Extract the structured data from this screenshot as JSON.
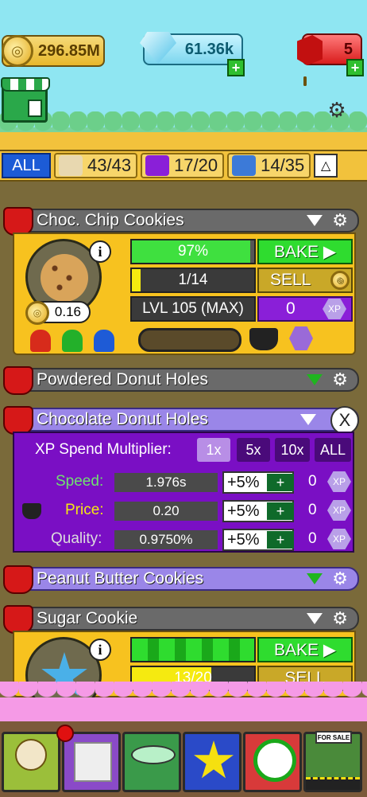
{
  "currency": {
    "coins": "296.85M",
    "gems": "61.36k",
    "tickets": "5"
  },
  "filters": {
    "all_label": "ALL",
    "cookies": "43/43",
    "boxes": "17/20",
    "gifts": "14/35"
  },
  "bakery_items": [
    {
      "name": "Choc. Chip Cookies",
      "progress_label": "97%",
      "progress_fraction": 0.97,
      "bake_label": "BAKE ▶",
      "stock_label": "1/14",
      "stock_fraction": 0.0714,
      "sell_label": "SELL",
      "level_label": "LVL 105 (MAX)",
      "xp_value": "0",
      "xp_badge": "XP",
      "price": "0.16",
      "info": "i"
    },
    {
      "name": "Powdered Donut Holes"
    },
    {
      "name": "Chocolate Donut Holes",
      "close": "X",
      "xp_spend_label": "XP Spend Multiplier:",
      "multipliers": [
        "1x",
        "5x",
        "10x",
        "ALL"
      ],
      "stats": [
        {
          "label": "Speed:",
          "value": "1.976s",
          "pct": "+5%",
          "plus": "+",
          "xp": "0",
          "xp_badge": "XP"
        },
        {
          "label": "Price:",
          "value": "0.20",
          "pct": "+5%",
          "plus": "+",
          "xp": "0",
          "xp_badge": "XP"
        },
        {
          "label": "Quality:",
          "value": "0.9750%",
          "pct": "+5%",
          "plus": "+",
          "xp": "0",
          "xp_badge": "XP"
        }
      ]
    },
    {
      "name": "Peanut Butter Cookies"
    },
    {
      "name": "Sugar Cookie",
      "bake_label": "BAKE ▶",
      "stock_label": "13/20",
      "sell_label": "SELL",
      "info": "i"
    }
  ],
  "bottom_nav": [
    "bakery",
    "gifts",
    "display",
    "star",
    "timer",
    "for-sale"
  ],
  "for_sale_label": "FOR SALE",
  "colors": {
    "sky": "#8fe6f2",
    "bake_green": "#2fdc2f",
    "xp_purple": "#8a1fd8"
  }
}
